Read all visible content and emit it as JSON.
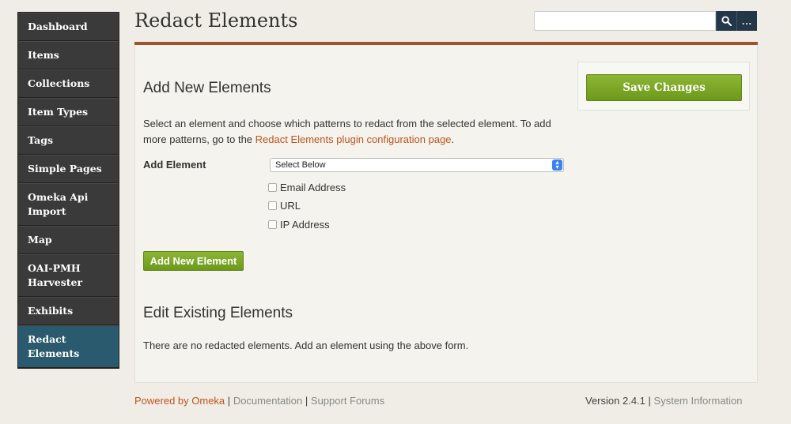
{
  "sidebar": {
    "items": [
      {
        "label": "Dashboard"
      },
      {
        "label": "Items"
      },
      {
        "label": "Collections"
      },
      {
        "label": "Item Types"
      },
      {
        "label": "Tags"
      },
      {
        "label": "Simple Pages"
      },
      {
        "label": "Omeka Api Import"
      },
      {
        "label": "Map"
      },
      {
        "label": "OAI-PMH Harvester"
      },
      {
        "label": "Exhibits"
      },
      {
        "label": "Redact Elements",
        "active": true
      }
    ]
  },
  "header": {
    "title": "Redact Elements",
    "search": {
      "value": "",
      "placeholder": ""
    },
    "advanced_label": "..."
  },
  "add_section": {
    "heading": "Add New Elements",
    "description_prefix": "Select an element and choose which patterns to redact from the selected element. To add more patterns, go to the ",
    "config_link": "Redact Elements plugin configuration page",
    "description_suffix": ".",
    "field_label": "Add Element",
    "select_value": "Select Below",
    "patterns": [
      "Email Address",
      "URL",
      "IP Address"
    ],
    "add_button": "Add New Element"
  },
  "edit_section": {
    "heading": "Edit Existing Elements",
    "empty_message": "There are no redacted elements. Add an element using the above form."
  },
  "save": {
    "label": "Save Changes"
  },
  "footer": {
    "powered": "Powered by Omeka",
    "documentation": "Documentation",
    "support": "Support Forums",
    "version": "Version 2.4.1",
    "system_info": "System Information"
  },
  "colors": {
    "accent": "#c2541d",
    "green": "#7aa526",
    "nav_dark": "#3a3a3a",
    "nav_active": "#2a5a6e"
  },
  "icons": {
    "search": "search-icon"
  }
}
